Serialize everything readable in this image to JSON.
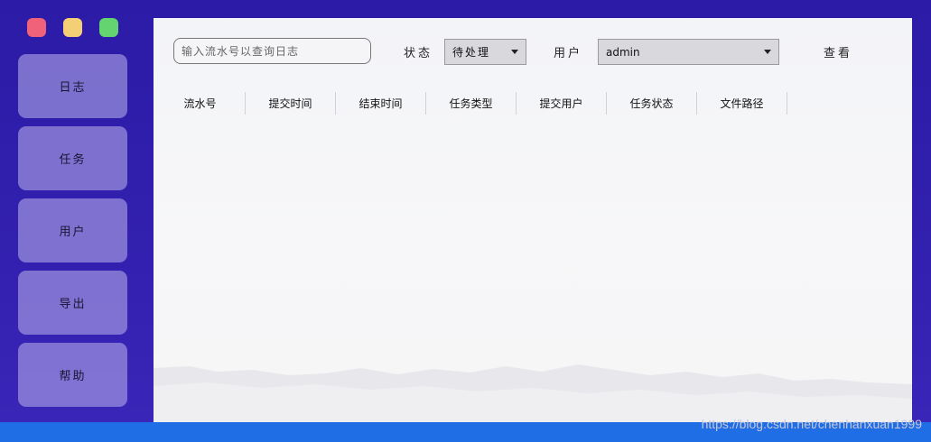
{
  "window": {
    "controls": [
      "close",
      "minimize",
      "maximize"
    ]
  },
  "sidebar": {
    "items": [
      {
        "label": "日志"
      },
      {
        "label": "任务"
      },
      {
        "label": "用户"
      },
      {
        "label": "导出"
      },
      {
        "label": "帮助"
      }
    ]
  },
  "toolbar": {
    "search_placeholder": "输入流水号以查询日志",
    "status_label": "状态",
    "status_value": "待处理",
    "user_label": "用户",
    "user_value": "admin",
    "view_label": "查看"
  },
  "table": {
    "columns": [
      "流水号",
      "提交时间",
      "结束时间",
      "任务类型",
      "提交用户",
      "任务状态",
      "文件路径"
    ]
  },
  "watermark": "https://blog.csdn.net/chenhanxuan1999",
  "colors": {
    "background": "#2f1ea8",
    "accent_bar": "#1f6ee6",
    "close": "#f0627a",
    "minimize": "#f3cf76",
    "maximize": "#63d46f"
  }
}
